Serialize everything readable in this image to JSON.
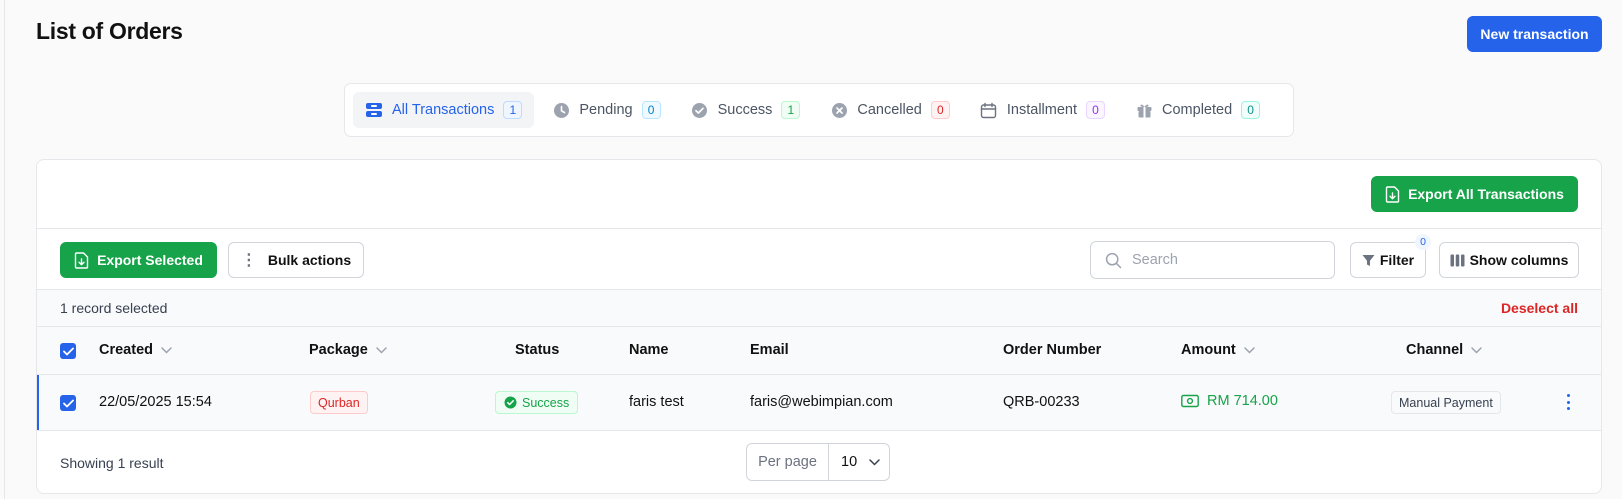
{
  "page": {
    "title": "List of Orders",
    "new_transaction_label": "New transaction"
  },
  "tabs": [
    {
      "label": "All Transactions",
      "count": "1",
      "icon": "inbox-stack-icon",
      "active": true
    },
    {
      "label": "Pending",
      "count": "0",
      "icon": "clock-icon"
    },
    {
      "label": "Success",
      "count": "1",
      "icon": "badge-check-icon"
    },
    {
      "label": "Cancelled",
      "count": "0",
      "icon": "x-circle-icon"
    },
    {
      "label": "Installment",
      "count": "0",
      "icon": "calendar-icon"
    },
    {
      "label": "Completed",
      "count": "0",
      "icon": "gift-icon"
    }
  ],
  "card": {
    "export_all_label": "Export All Transactions"
  },
  "toolbar": {
    "export_selected_label": "Export Selected",
    "bulk_actions_label": "Bulk actions",
    "search_placeholder": "Search",
    "filter_label": "Filter",
    "filter_count": "0",
    "show_columns_label": "Show columns"
  },
  "selection": {
    "text": "1 record selected",
    "deselect_label": "Deselect all"
  },
  "table": {
    "columns": {
      "created": "Created",
      "package": "Package",
      "status": "Status",
      "name": "Name",
      "email": "Email",
      "order_number": "Order Number",
      "amount": "Amount",
      "channel": "Channel"
    },
    "rows": [
      {
        "created": "22/05/2025 15:54",
        "package": "Qurban",
        "status": "Success",
        "name": "faris test",
        "email": "faris@webimpian.com",
        "order_number": "QRB-00233",
        "amount": "RM 714.00",
        "channel": "Manual Payment",
        "selected": true
      }
    ]
  },
  "footer": {
    "showing": "Showing 1 result",
    "per_page_label": "Per page",
    "per_page_value": "10"
  },
  "colors": {
    "primary": "#2563eb",
    "success": "#16a34a",
    "danger": "#dc2626"
  }
}
